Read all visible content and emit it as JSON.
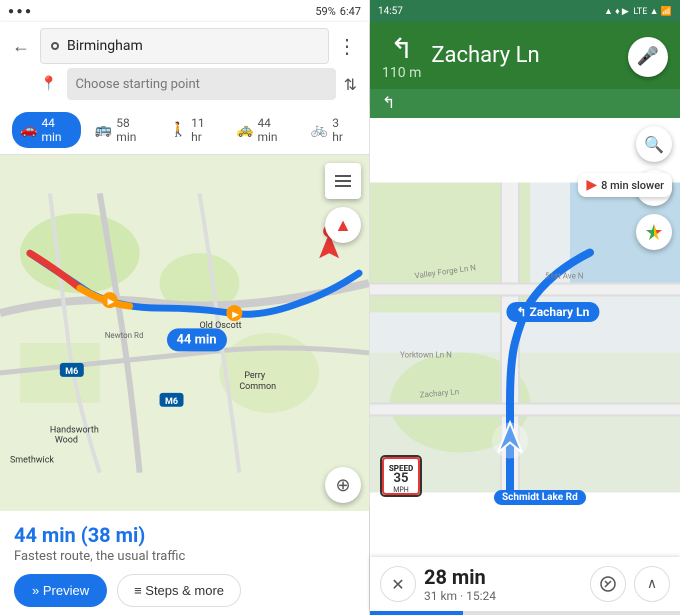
{
  "left": {
    "statusBar": {
      "time": "6:47",
      "battery": "59%"
    },
    "searchBar": {
      "destination": "Birmingham",
      "placeholder": "Choose starting point",
      "menuLabel": "⋮"
    },
    "transportTabs": [
      {
        "id": "drive",
        "icon": "🚗",
        "label": "44 min",
        "active": true
      },
      {
        "id": "transit",
        "icon": "🚌",
        "label": "58 min",
        "active": false
      },
      {
        "id": "walk",
        "icon": "🚶",
        "label": "11 hr",
        "active": false
      },
      {
        "id": "rideshare",
        "icon": "🚕",
        "label": "44 min",
        "active": false
      },
      {
        "id": "cycle",
        "icon": "🚲",
        "label": "3 hr",
        "active": false
      }
    ],
    "map": {
      "routeLabel": "44 min"
    },
    "bottomPanel": {
      "routeTime": "44 min (38 mi)",
      "routeDesc": "Fastest route, the usual traffic",
      "previewLabel": "» Preview",
      "stepsLabel": "≡ Steps & more"
    }
  },
  "right": {
    "statusBar": {
      "time": "14:57",
      "icons": "▲ ▲ ▶ LTE ▲"
    },
    "navHeader": {
      "turnArrow": "↰",
      "streetName": "Zachary",
      "streetSuffix": " Ln",
      "distance": "110 m",
      "micIcon": "🎤"
    },
    "turnPreview": {
      "arrow": "↰"
    },
    "map": {
      "speedLimit": "35",
      "speedUnit": "MPH",
      "slowerBadge": "8 min slower",
      "zacharyLabel": "↰ Zachary Ln",
      "schmidtLabel": "Schmidt Lake Rd"
    },
    "bottomPanel": {
      "cancelLabel": "✕",
      "navTime": "28 min",
      "navDetails": "31 km · 15:24",
      "routeOptionsLabel": "⑂",
      "expandLabel": "∧"
    }
  }
}
